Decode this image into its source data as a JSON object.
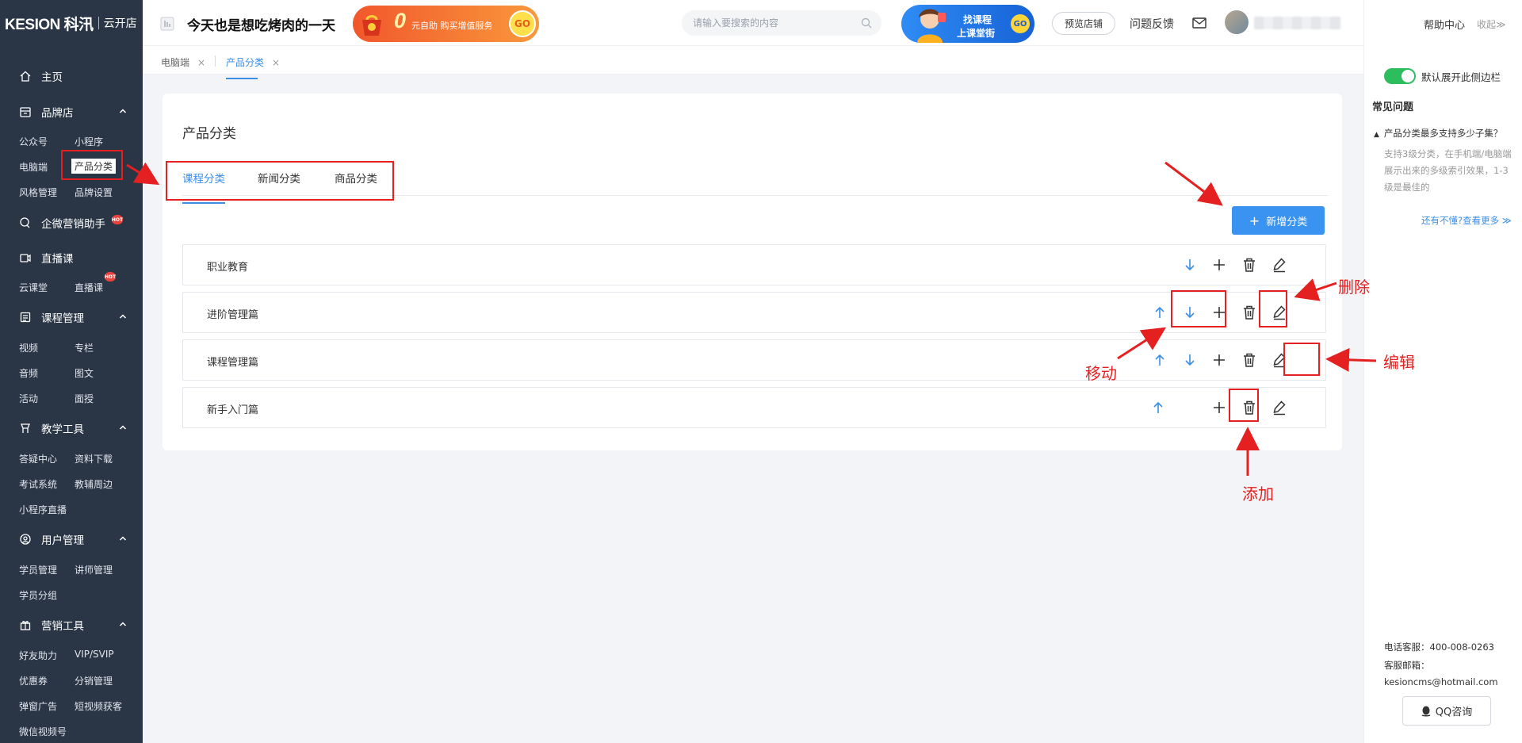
{
  "brand": {
    "logo": "KESION 科汛",
    "store": "云开店"
  },
  "sidebar": {
    "home": "主页",
    "groups": [
      {
        "label": "品牌店",
        "items": [
          "公众号",
          "小程序",
          "电脑端",
          "产品分类",
          "风格管理",
          "品牌设置"
        ]
      },
      {
        "label": "企微营销助手",
        "hot": "HOT"
      },
      {
        "label": "直播课",
        "items": [
          "云课堂",
          "直播课"
        ],
        "hot": "HOT"
      },
      {
        "label": "课程管理",
        "items": [
          "视频",
          "专栏",
          "音频",
          "图文",
          "活动",
          "面授"
        ]
      },
      {
        "label": "教学工具",
        "items": [
          "答疑中心",
          "资料下载",
          "考试系统",
          "教辅周边",
          "小程序直播"
        ]
      },
      {
        "label": "用户管理",
        "items": [
          "学员管理",
          "讲师管理",
          "学员分组"
        ]
      },
      {
        "label": "营销工具",
        "items": [
          "好友助力",
          "VIP/SVIP",
          "优惠券",
          "分销管理",
          "弹窗广告",
          "短视频获客",
          "微信视频号"
        ]
      }
    ]
  },
  "header": {
    "slogan": "今天也是想吃烤肉的一天",
    "promo": {
      "zero": "0",
      "text": "元自助  购买增值服务",
      "go": "GO"
    },
    "search_placeholder": "请输入要搜索的内容",
    "banner": {
      "line1": "找课程",
      "line2": "上课堂街",
      "go": "GO"
    },
    "preview": "预览店铺",
    "feedback": "问题反馈"
  },
  "right_panel": {
    "help": "帮助中心",
    "collapse": "收起≫",
    "toggle_label": "默认展开此侧边栏",
    "faq_title": "常见问题",
    "faq_question": "产品分类最多支持多少子集？",
    "faq_answer": "支持3级分类，在手机端/电脑端展示出来的多级索引效果，1-3级是最佳的",
    "faq_more": "还有不懂?查看更多 ≫",
    "phone": "电话客服：400-008-0263",
    "email": "客服邮箱：kesioncms@hotmail.com",
    "qq": "QQ咨询"
  },
  "page_tabs": [
    {
      "label": "电脑端",
      "close": "×"
    },
    {
      "label": "产品分类",
      "close": "×"
    }
  ],
  "main": {
    "title": "产品分类",
    "tabs": [
      "课程分类",
      "新闻分类",
      "商品分类"
    ],
    "add_button": "新增分类",
    "rows": [
      {
        "name": "职业教育",
        "up": false,
        "down": true
      },
      {
        "name": "进阶管理篇",
        "up": true,
        "down": true
      },
      {
        "name": "课程管理篇",
        "up": true,
        "down": true
      },
      {
        "name": "新手入门篇",
        "up": true,
        "down": false
      }
    ]
  },
  "annotations": {
    "delete": "删除",
    "move": "移动",
    "edit": "编辑",
    "add": "添加"
  },
  "colors": {
    "sidebar_bg": "#2a3545",
    "accent": "#3a93f0",
    "annotation": "#e52020",
    "toggle": "#2dbd5c"
  }
}
